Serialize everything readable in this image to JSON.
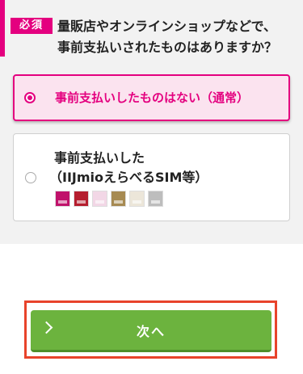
{
  "question": {
    "required_label": "必須",
    "text": "量販店やオンラインショップなどで、\n事前支払いされたものはありますか？"
  },
  "options": [
    {
      "label": "事前支払いしたものはない（通常）",
      "selected": true
    },
    {
      "label_line1": "事前支払いした",
      "label_line2": "（IIJmioえらべるSIM等）",
      "selected": false,
      "card_images": [
        {
          "name": "sim-card-image-1",
          "color": "#c0126b"
        },
        {
          "name": "sim-card-image-2",
          "color": "#b51e2f"
        },
        {
          "name": "sim-card-image-3",
          "color": "#f2d7e6"
        },
        {
          "name": "sim-card-image-4",
          "color": "#a68a52"
        },
        {
          "name": "sim-card-image-5",
          "color": "#ece6d9"
        },
        {
          "name": "sim-card-image-6",
          "color": "#bdbdbd"
        }
      ]
    }
  ],
  "next_button": {
    "label": "次へ",
    "icon": "chevron-right-icon"
  },
  "colors": {
    "brand": "#e4007f",
    "button": "#6cb33e",
    "highlight_frame": "#e8432b"
  }
}
